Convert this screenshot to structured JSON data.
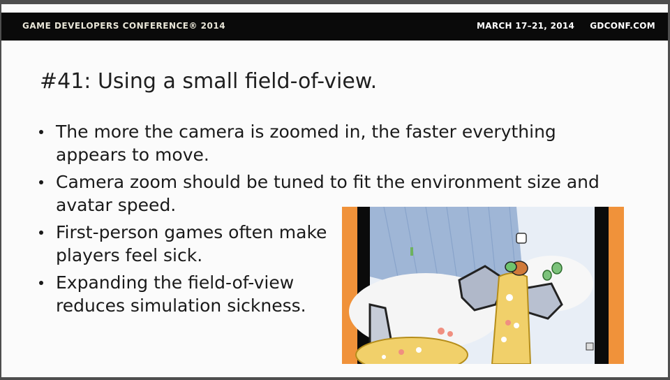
{
  "header": {
    "conference": "GAME DEVELOPERS CONFERENCE® 2014",
    "dates": "MARCH 17–21, 2014",
    "website": "GDCONF.COM"
  },
  "slide": {
    "title": "#41: Using a small field-of-view.",
    "bullets": [
      "The more the camera is zoomed in, the faster everything appears to move.",
      "Camera zoom should be tuned to fit the environment size and avatar speed.",
      "First-person games often make players feel sick.",
      "Expanding the field-of-view reduces simulation sickness."
    ]
  },
  "colors": {
    "banner_bg": "#0a0a0a",
    "banner_text": "#e9e6d8",
    "slide_bg": "#fbfbfb",
    "text": "#1a1a1a",
    "pillar_orange": "#f0923a"
  },
  "icons": {
    "bullet": "bullet-dot-icon"
  }
}
